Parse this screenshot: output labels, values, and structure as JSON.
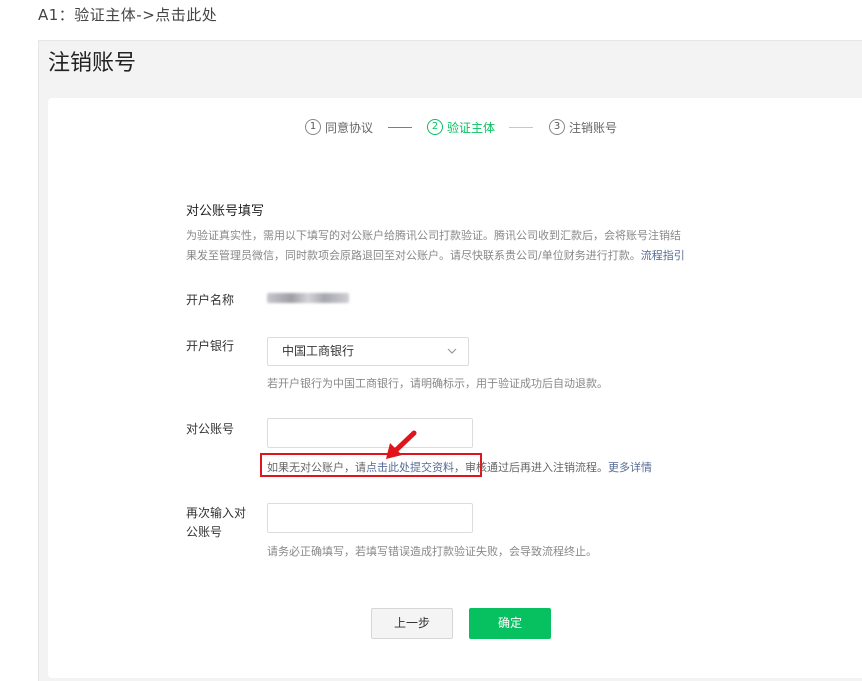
{
  "caption": "A1：验证主体->点击此处",
  "page_title": "注销账号",
  "steps": [
    {
      "num": "1",
      "label": "同意协议",
      "active": false
    },
    {
      "num": "2",
      "label": "验证主体",
      "active": true
    },
    {
      "num": "3",
      "label": "注销账号",
      "active": false
    }
  ],
  "section": {
    "title": "对公账号填写",
    "desc_line1": "为验证真实性，需用以下填写的对公账户给腾讯公司打款验证。腾讯公司收到汇款后，会将账号注销结",
    "desc_line2": "果发至管理员微信，同时款项会原路退回至对公账户。请尽快联系贵公司/单位财务进行打款。",
    "desc_link": "流程指引"
  },
  "form": {
    "account_name_label": "开户名称",
    "bank_label": "开户银行",
    "bank_selected": "中国工商银行",
    "bank_hint": "若开户银行为中国工商银行，请明确标示，用于验证成功后自动退款。",
    "account_label": "对公账号",
    "no_account_prefix": "如果无对公账户，请",
    "no_account_link": "点击此处提交资料",
    "no_account_suffix": "，审核通过后再进入注销流程。",
    "more_details": "更多详情",
    "reenter_label_line1": "再次输入对",
    "reenter_label_line2": "公账号",
    "reenter_hint": "请务必正确填写，若填写错误造成打款验证失败，会导致流程终止。"
  },
  "buttons": {
    "prev": "上一步",
    "confirm": "确定"
  },
  "colors": {
    "accent": "#07c160",
    "link": "#576b95",
    "highlight": "#e0151b"
  }
}
